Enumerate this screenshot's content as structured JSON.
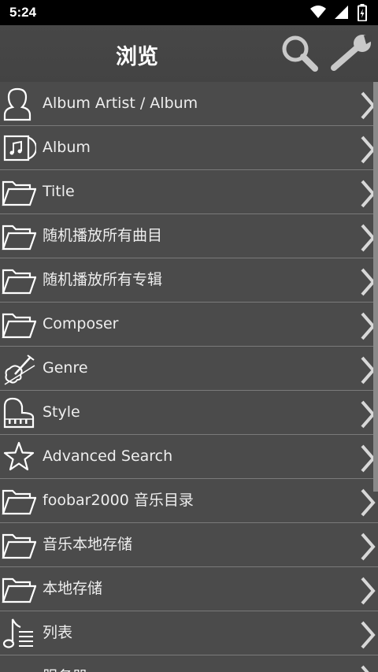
{
  "status": {
    "time": "5:24"
  },
  "header": {
    "title": "浏览"
  },
  "rows": [
    {
      "label": "Album Artist / Album",
      "icon": "person-icon"
    },
    {
      "label": "Album",
      "icon": "album-icon"
    },
    {
      "label": "Title",
      "icon": "folder-icon"
    },
    {
      "label": "随机播放所有曲目",
      "icon": "folder-icon"
    },
    {
      "label": "随机播放所有专辑",
      "icon": "folder-icon"
    },
    {
      "label": "Composer",
      "icon": "folder-icon"
    },
    {
      "label": "Genre",
      "icon": "violin-icon"
    },
    {
      "label": "Style",
      "icon": "piano-icon"
    },
    {
      "label": "Advanced Search",
      "icon": "star-icon"
    },
    {
      "label": "foobar2000 音乐目录",
      "icon": "folder-icon"
    },
    {
      "label": "音乐本地存储",
      "icon": "folder-icon"
    },
    {
      "label": "本地存储",
      "icon": "folder-icon"
    },
    {
      "label": "列表",
      "icon": "playlist-icon"
    },
    {
      "label": "服务器",
      "icon": "server-icon"
    }
  ]
}
